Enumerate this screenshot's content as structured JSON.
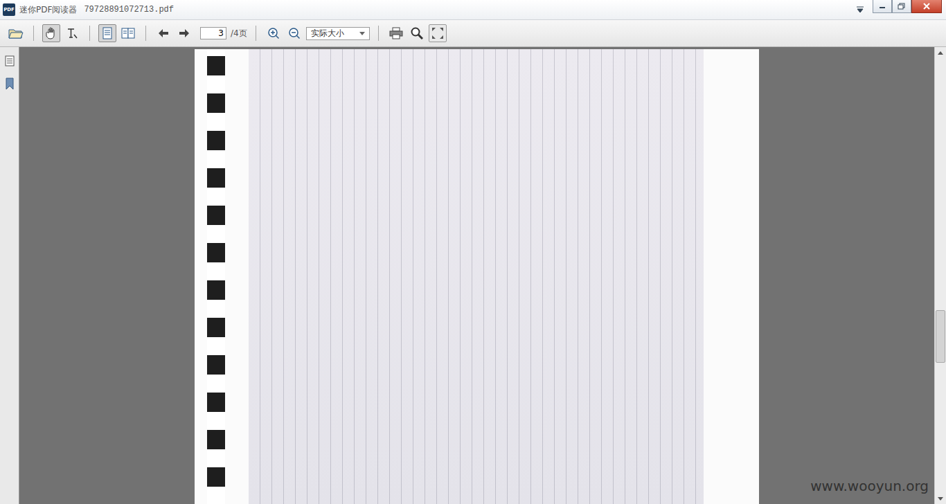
{
  "window": {
    "app_icon": "PDF",
    "title": "迷你PDF阅读器",
    "file": "79728891072713.pdf"
  },
  "mode_tools": [
    {
      "selected": true
    },
    {
      "selected": false
    }
  ],
  "view_tools": [
    {
      "selected": true
    },
    {
      "selected": false
    }
  ],
  "page": {
    "current": "3",
    "total": "/4页"
  },
  "zoom": {
    "value": "实际大小"
  },
  "scroll": {
    "position": 0.58,
    "thumb": 0.12
  },
  "watermark": "www.wooyun.org"
}
